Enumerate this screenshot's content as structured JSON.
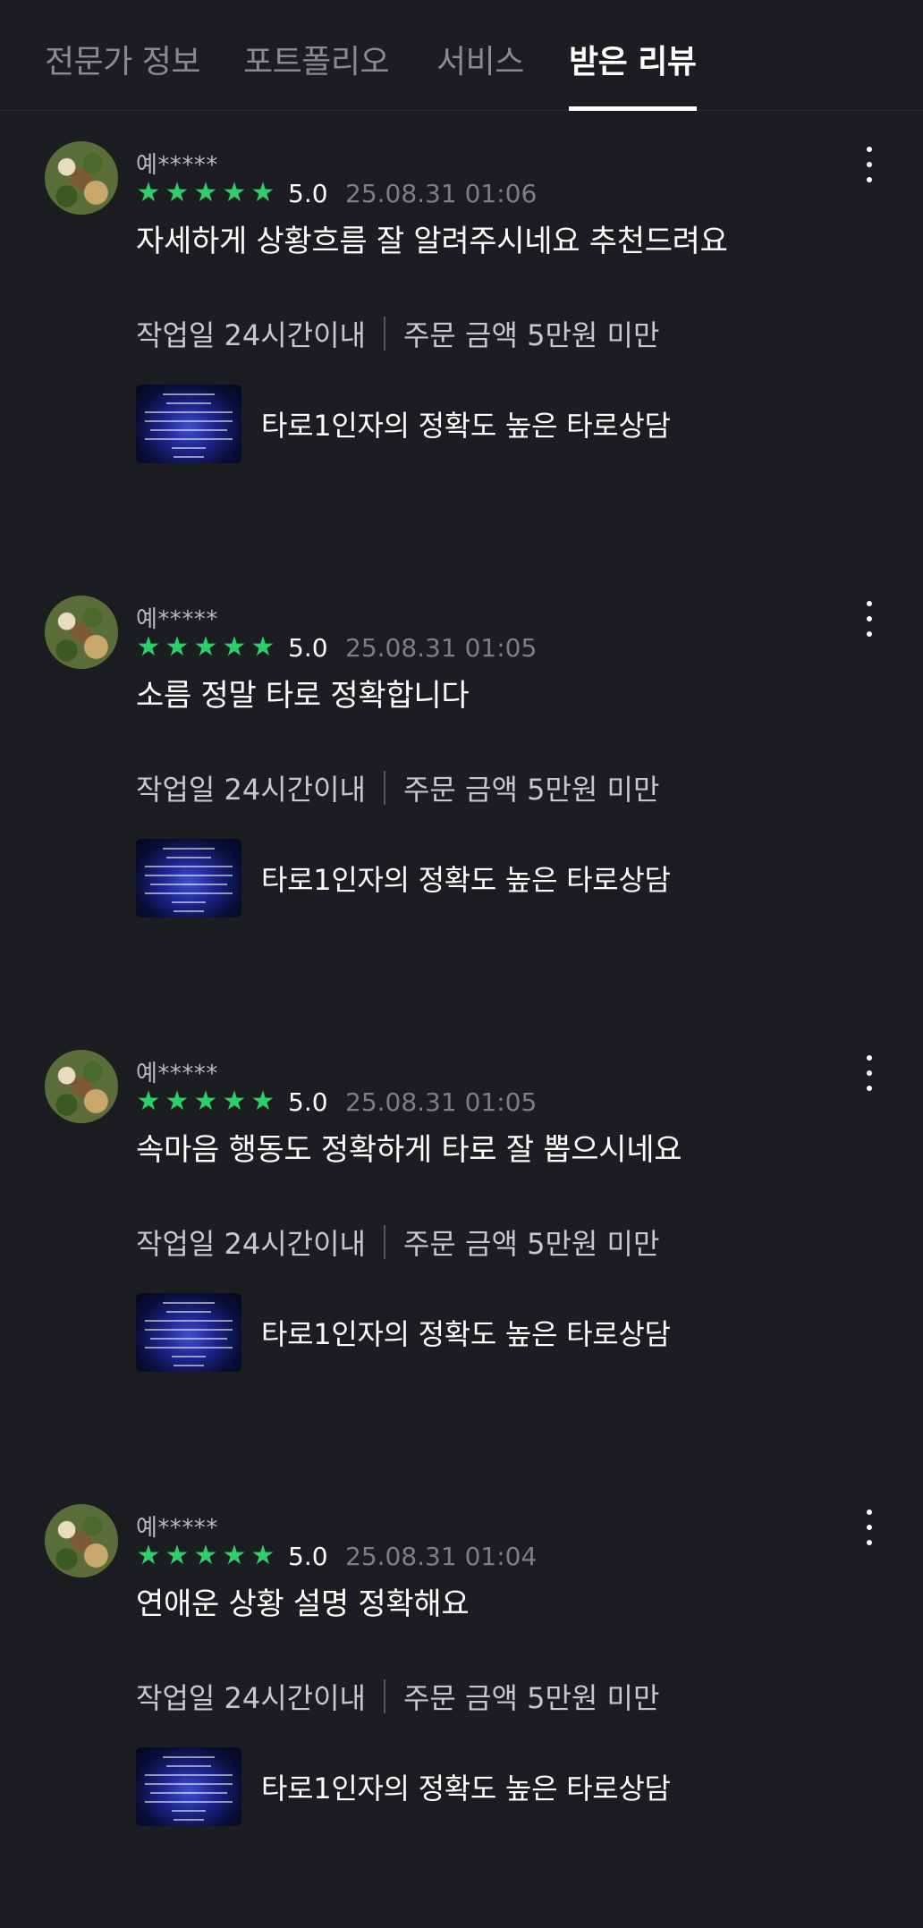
{
  "tabs": [
    {
      "label": "전문가 정보",
      "active": false
    },
    {
      "label": "포트폴리오",
      "active": false
    },
    {
      "label": "서비스",
      "active": false
    },
    {
      "label": "받은 리뷰",
      "active": true
    }
  ],
  "accent_color": "#2ecf6a",
  "reviews": [
    {
      "username": "예*****",
      "stars": 5,
      "rating": "5.0",
      "date": "25.08.31 01:06",
      "content": "자세하게 상황흐름 잘 알려주시네요 추천드려요",
      "work_period": "작업일 24시간이내",
      "order_amount": "주문 금액 5만원 미만",
      "service_title": "타로1인자의 정확도 높은 타로상담"
    },
    {
      "username": "예*****",
      "stars": 5,
      "rating": "5.0",
      "date": "25.08.31 01:05",
      "content": "소름 정말 타로 정확합니다",
      "work_period": "작업일 24시간이내",
      "order_amount": "주문 금액 5만원 미만",
      "service_title": "타로1인자의 정확도 높은 타로상담"
    },
    {
      "username": "예*****",
      "stars": 5,
      "rating": "5.0",
      "date": "25.08.31 01:05",
      "content": "속마음 행동도 정확하게 타로 잘 뽑으시네요",
      "work_period": "작업일 24시간이내",
      "order_amount": "주문 금액 5만원 미만",
      "service_title": "타로1인자의 정확도 높은 타로상담"
    },
    {
      "username": "예*****",
      "stars": 5,
      "rating": "5.0",
      "date": "25.08.31 01:04",
      "content": "연애운 상황 설명 정확해요",
      "work_period": "작업일 24시간이내",
      "order_amount": "주문 금액 5만원 미만",
      "service_title": "타로1인자의 정확도 높은 타로상담"
    }
  ]
}
